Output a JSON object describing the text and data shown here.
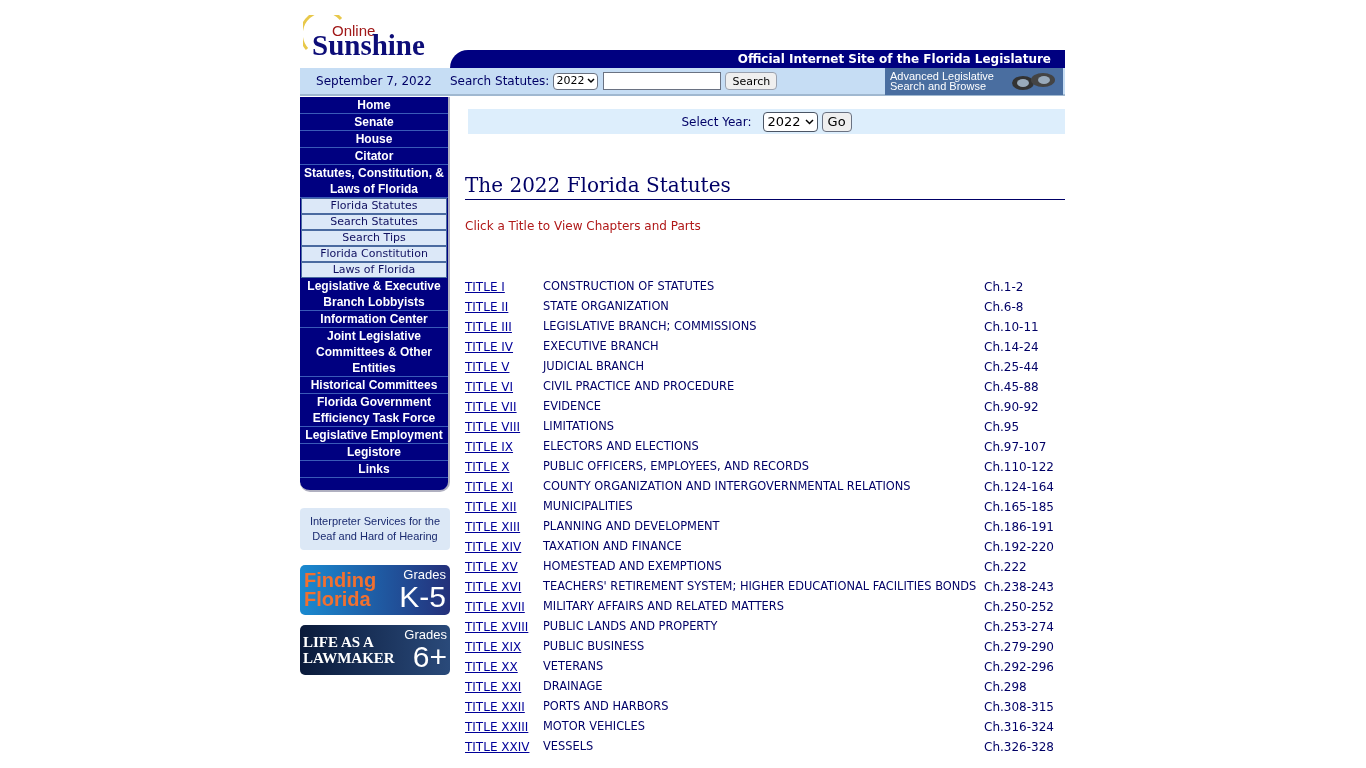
{
  "header": {
    "logo_small": "Online",
    "logo_big": "Sunshine",
    "tagline": "Official Internet Site of the Florida Legislature",
    "date": "September 7, 2022",
    "search_label": "Search Statutes:",
    "search_year": "2022",
    "search_button": "Search",
    "advanced_line1": "Advanced Legislative",
    "advanced_line2": "Search and Browse"
  },
  "sidebar": {
    "items": [
      {
        "label": "Home",
        "kind": "main"
      },
      {
        "label": "Senate",
        "kind": "main"
      },
      {
        "label": "House",
        "kind": "main"
      },
      {
        "label": "Citator",
        "kind": "main"
      },
      {
        "label": "Statutes, Constitution, & Laws of Florida",
        "kind": "main"
      },
      {
        "label": "Florida Statutes",
        "kind": "sub"
      },
      {
        "label": "Search Statutes",
        "kind": "sub"
      },
      {
        "label": "Search Tips",
        "kind": "sub"
      },
      {
        "label": "Florida Constitution",
        "kind": "sub"
      },
      {
        "label": "Laws of Florida",
        "kind": "sub"
      },
      {
        "label": "Legislative & Executive Branch Lobbyists",
        "kind": "main"
      },
      {
        "label": "Information Center",
        "kind": "main"
      },
      {
        "label": "Joint Legislative Committees & Other Entities",
        "kind": "main"
      },
      {
        "label": "Historical Committees",
        "kind": "main"
      },
      {
        "label": "Florida Government Efficiency Task Force",
        "kind": "main"
      },
      {
        "label": "Legislative Employment",
        "kind": "main"
      },
      {
        "label": "Legistore",
        "kind": "main"
      },
      {
        "label": "Links",
        "kind": "main"
      }
    ],
    "interpreter": "Interpreter Services for the Deaf and Hard of Hearing",
    "banners": [
      {
        "kind": "finding",
        "line1": "Finding",
        "line2": "Florida",
        "grades": "Grades",
        "level": "K-5"
      },
      {
        "kind": "lawmaker",
        "line1": "LIFE AS A",
        "line2": "LAWMAKER",
        "grades": "Grades",
        "level": "6+"
      }
    ]
  },
  "year_select": {
    "label": "Select Year:",
    "value": "2022",
    "button": "Go"
  },
  "heading": "The 2022 Florida Statutes",
  "instruction": "Click a Title to View Chapters and Parts",
  "titles": [
    {
      "title": "TITLE I",
      "name": "CONSTRUCTION OF STATUTES",
      "chapters": "Ch.1-2"
    },
    {
      "title": "TITLE II",
      "name": "STATE ORGANIZATION",
      "chapters": "Ch.6-8"
    },
    {
      "title": "TITLE III",
      "name": "LEGISLATIVE BRANCH; COMMISSIONS",
      "chapters": "Ch.10-11"
    },
    {
      "title": "TITLE IV",
      "name": "EXECUTIVE BRANCH",
      "chapters": "Ch.14-24"
    },
    {
      "title": "TITLE V",
      "name": "JUDICIAL BRANCH",
      "chapters": "Ch.25-44"
    },
    {
      "title": "TITLE VI",
      "name": "CIVIL PRACTICE AND PROCEDURE",
      "chapters": "Ch.45-88"
    },
    {
      "title": "TITLE VII",
      "name": "EVIDENCE",
      "chapters": "Ch.90-92"
    },
    {
      "title": "TITLE VIII",
      "name": "LIMITATIONS",
      "chapters": "Ch.95"
    },
    {
      "title": "TITLE IX",
      "name": "ELECTORS AND ELECTIONS",
      "chapters": "Ch.97-107"
    },
    {
      "title": "TITLE X",
      "name": "PUBLIC OFFICERS, EMPLOYEES, AND RECORDS",
      "chapters": "Ch.110-122"
    },
    {
      "title": "TITLE XI",
      "name": "COUNTY ORGANIZATION AND INTERGOVERNMENTAL RELATIONS",
      "chapters": "Ch.124-164"
    },
    {
      "title": "TITLE XII",
      "name": "MUNICIPALITIES",
      "chapters": "Ch.165-185"
    },
    {
      "title": "TITLE XIII",
      "name": "PLANNING AND DEVELOPMENT",
      "chapters": "Ch.186-191"
    },
    {
      "title": "TITLE XIV",
      "name": "TAXATION AND FINANCE",
      "chapters": "Ch.192-220"
    },
    {
      "title": "TITLE XV",
      "name": "HOMESTEAD AND EXEMPTIONS",
      "chapters": "Ch.222"
    },
    {
      "title": "TITLE XVI",
      "name": "TEACHERS' RETIREMENT SYSTEM; HIGHER EDUCATIONAL FACILITIES BONDS",
      "chapters": "Ch.238-243"
    },
    {
      "title": "TITLE XVII",
      "name": "MILITARY AFFAIRS AND RELATED MATTERS",
      "chapters": "Ch.250-252"
    },
    {
      "title": "TITLE XVIII",
      "name": "PUBLIC LANDS AND PROPERTY",
      "chapters": "Ch.253-274"
    },
    {
      "title": "TITLE XIX",
      "name": "PUBLIC BUSINESS",
      "chapters": "Ch.279-290"
    },
    {
      "title": "TITLE XX",
      "name": "VETERANS",
      "chapters": "Ch.292-296"
    },
    {
      "title": "TITLE XXI",
      "name": "DRAINAGE",
      "chapters": "Ch.298"
    },
    {
      "title": "TITLE XXII",
      "name": "PORTS AND HARBORS",
      "chapters": "Ch.308-315"
    },
    {
      "title": "TITLE XXIII",
      "name": "MOTOR VEHICLES",
      "chapters": "Ch.316-324"
    },
    {
      "title": "TITLE XXIV",
      "name": "VESSELS",
      "chapters": "Ch.326-328"
    }
  ]
}
